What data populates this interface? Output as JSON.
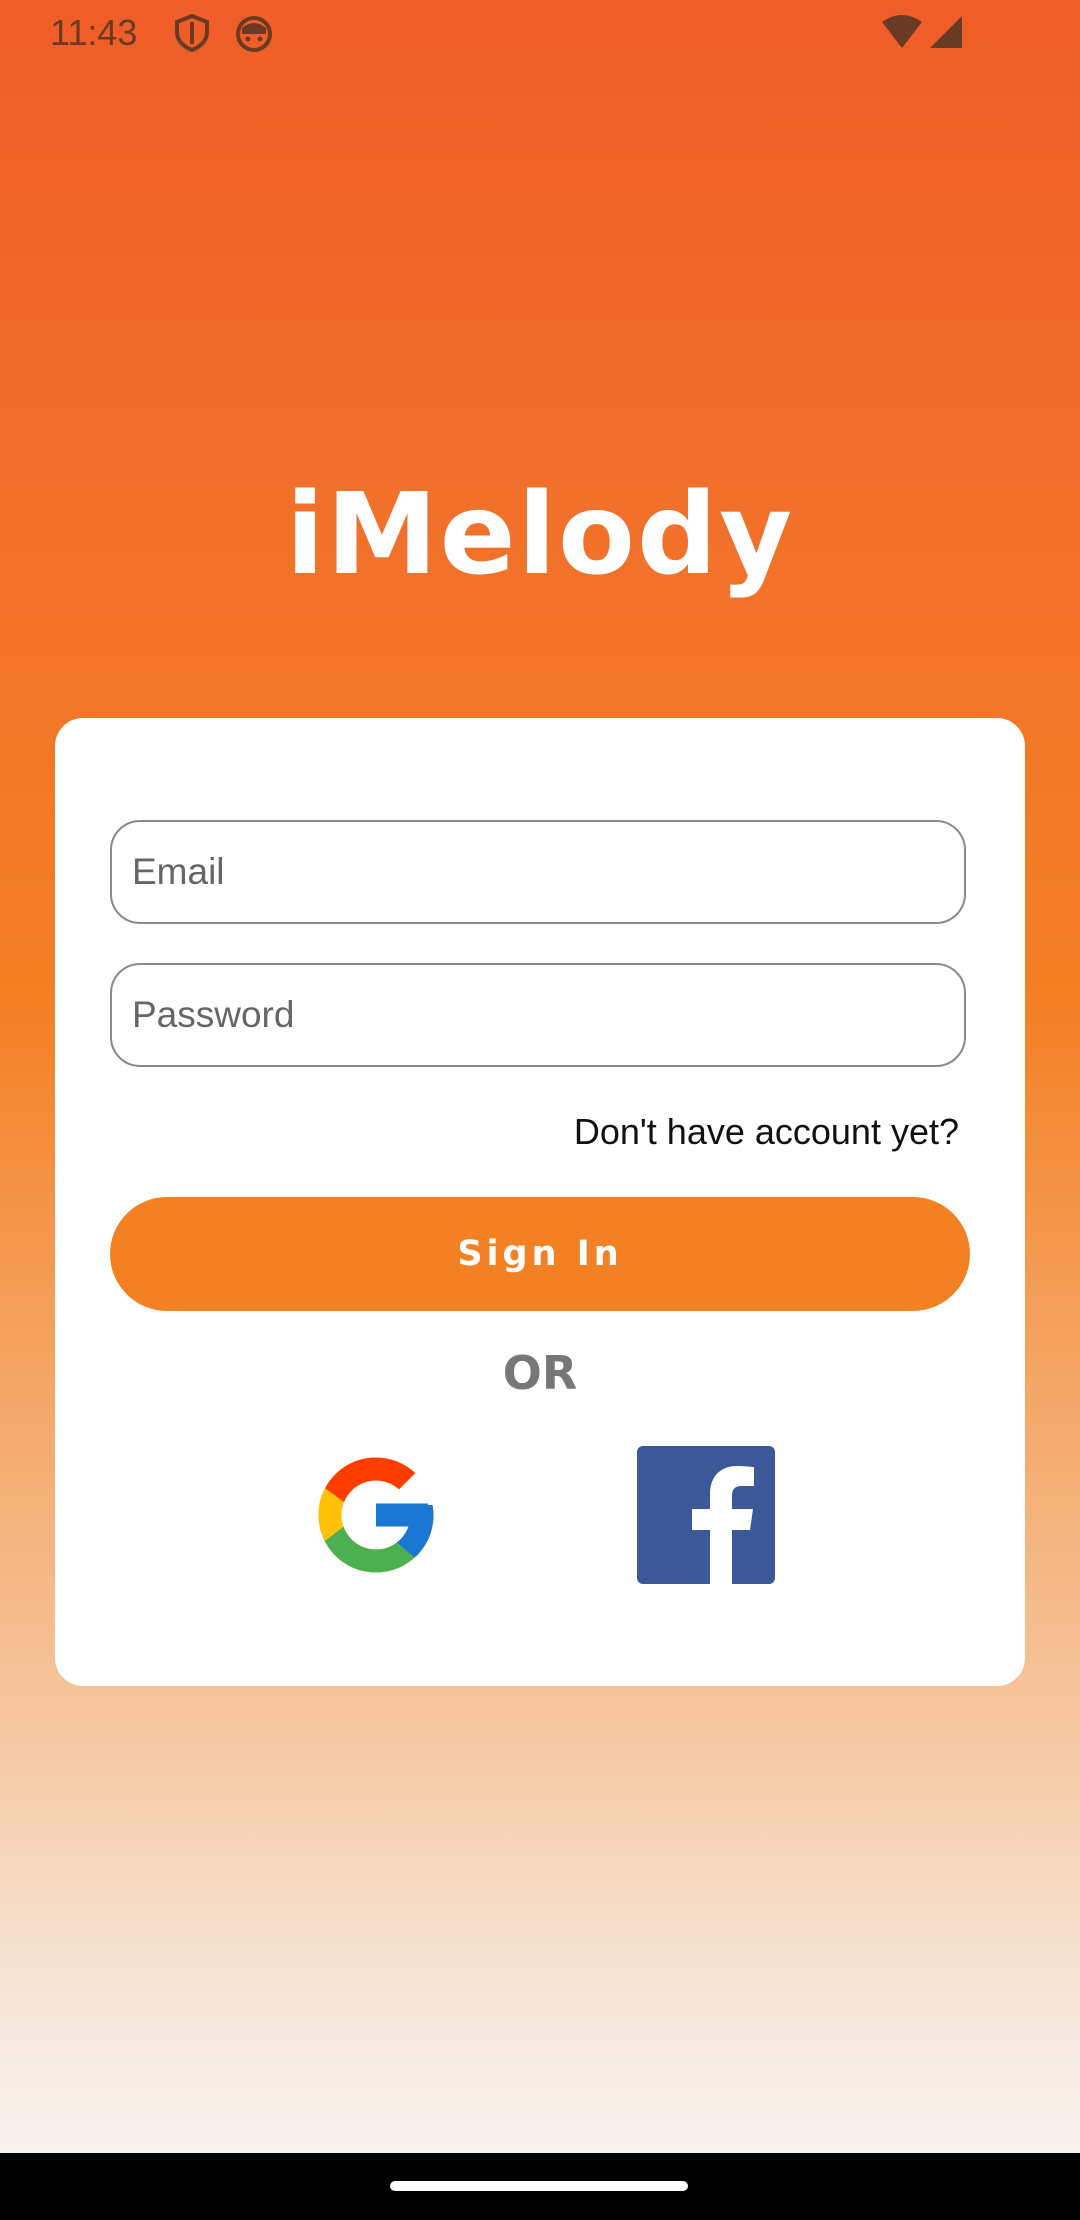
{
  "status_bar": {
    "time": "11:43",
    "left_icons": [
      "shield-icon",
      "android-head-icon"
    ],
    "right_icons": [
      "wifi-icon",
      "cell-signal-icon"
    ]
  },
  "app": {
    "logo_text": "iMelody"
  },
  "login_form": {
    "email_placeholder": "Email",
    "email_value": "",
    "password_placeholder": "Password",
    "password_value": "",
    "register_link": "Don't have account yet?",
    "sign_in_label": "Sign In",
    "or_label": "OR",
    "social_logins": [
      "google-icon",
      "facebook-icon"
    ]
  },
  "colors": {
    "accent": "#f38123",
    "gradient_top": "#ef5d28",
    "gradient_bottom": "#f7f3ef",
    "facebook_blue": "#3b5998"
  }
}
